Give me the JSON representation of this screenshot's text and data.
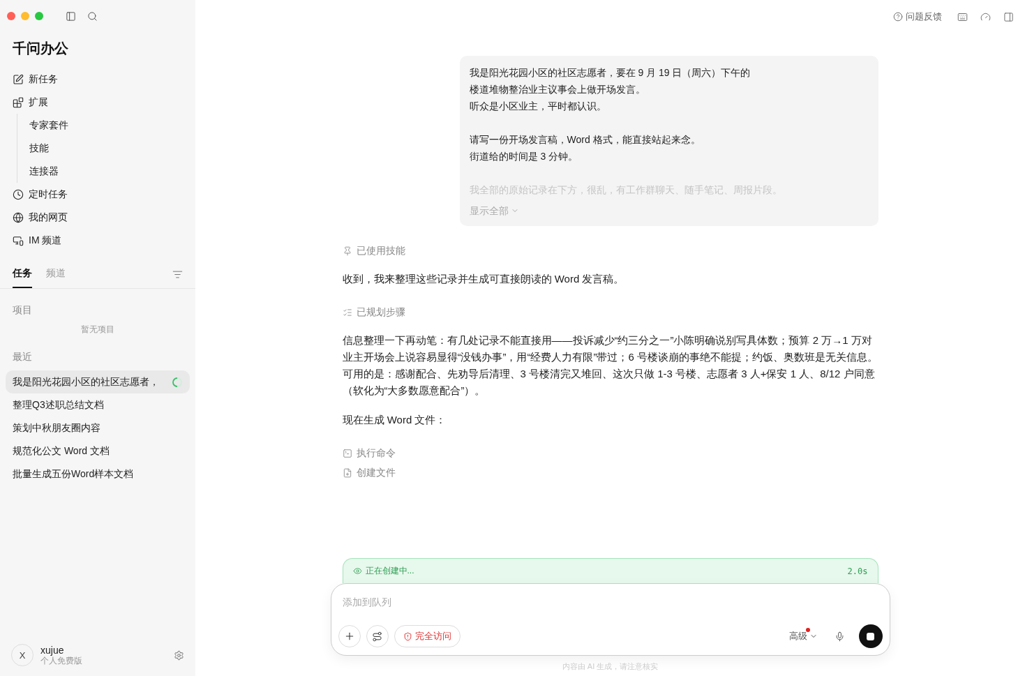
{
  "sidebar": {
    "app_title": "千问办公",
    "nav": [
      {
        "kind": "new",
        "label": "新任务"
      },
      {
        "kind": "extend",
        "label": "扩展"
      },
      {
        "kind": "sub",
        "label": "专家套件"
      },
      {
        "kind": "sub",
        "label": "技能"
      },
      {
        "kind": "sub",
        "label": "连接器"
      },
      {
        "kind": "schedule",
        "label": "定时任务"
      },
      {
        "kind": "web",
        "label": "我的网页"
      },
      {
        "kind": "im",
        "label": "IM 频道"
      }
    ],
    "tabs": [
      {
        "label": "任务",
        "selected": true
      },
      {
        "label": "频道",
        "selected": false
      }
    ],
    "projects": {
      "heading": "项目",
      "empty": "暂无项目"
    },
    "recent": {
      "heading": "最近",
      "items": [
        {
          "label": "我是阳光花园小区的社区志愿者，",
          "selected": true,
          "running": true
        },
        {
          "label": "整理Q3述职总结文档",
          "selected": false,
          "running": false
        },
        {
          "label": "策划中秋朋友圈内容",
          "selected": false,
          "running": false
        },
        {
          "label": "规范化公文 Word 文档",
          "selected": false,
          "running": false
        },
        {
          "label": "批量生成五份Word样本文档",
          "selected": false,
          "running": false
        }
      ]
    },
    "user": {
      "avatar": "X",
      "name": "xujue",
      "plan": "个人免费版"
    }
  },
  "topbar": {
    "feedback": "问题反馈"
  },
  "chat": {
    "user_message": {
      "paragraphs": [
        [
          "我是阳光花园小区的社区志愿者，要在 9 月 19 日（周六）下午的",
          "楼道堆物整治业主议事会上做开场发言。",
          "听众是小区业主，平时都认识。"
        ],
        [
          "请写一份开场发言稿，Word 格式，能直接站起来念。",
          "街道给的时间是 3 分钟。"
        ]
      ],
      "faded_line": "我全部的原始记录在下方，很乱，有工作群聊天、随手笔记、周报片段。",
      "show_all": "显示全部"
    },
    "steps": [
      {
        "kind": "skill",
        "text": "已使用技能"
      },
      {
        "kind": "text",
        "text": "收到，我来整理这些记录并生成可直接朗读的 Word 发言稿。"
      },
      {
        "kind": "plan",
        "text": "已规划步骤"
      },
      {
        "kind": "text",
        "text": "信息整理一下再动笔：有几处记录不能直接用——投诉减少“约三分之一”小陈明确说别写具体数；预算 2 万→1 万对业主开场会上说容易显得“没钱办事”，用“经费人力有限”带过；6 号楼谈崩的事绝不能提；约饭、奥数班是无关信息。可用的是：感谢配合、先劝导后清理、3 号楼清完又堆回、这次只做 1-3 号楼、志愿者 3 人+保安 1 人、8/12 户同意（软化为“大多数愿意配合”）。"
      },
      {
        "kind": "text",
        "text": "现在生成 Word 文件："
      },
      {
        "kind": "command",
        "text": "执行命令"
      },
      {
        "kind": "file",
        "text": "创建文件"
      }
    ]
  },
  "status_banner": {
    "text": "正在创建中...",
    "time": "2.0s"
  },
  "composer": {
    "placeholder": "添加到队列",
    "access": "完全访问",
    "mode": "高级",
    "mode_alert": true
  },
  "footer_note": "内容由 AI 生成，请注意核实"
}
